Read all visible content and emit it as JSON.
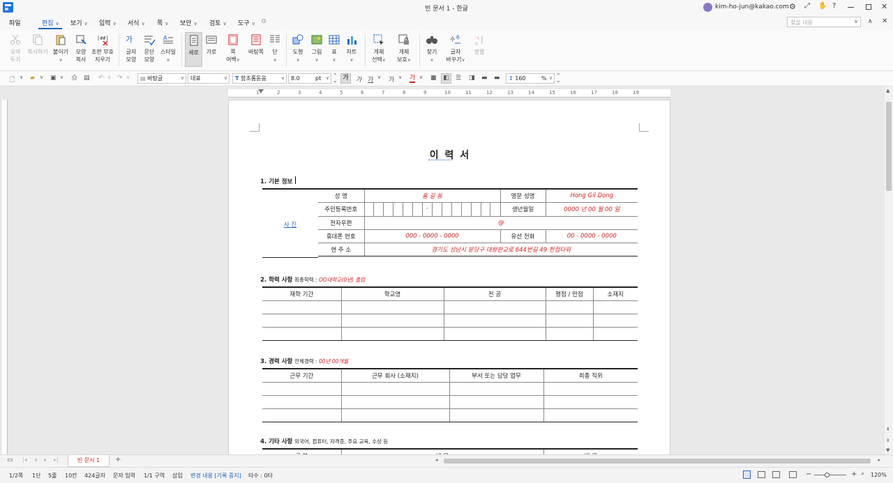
{
  "app": {
    "window_title": "빈 문서 1 - 한글",
    "user_email": "kim-ho-jun@kakao.com",
    "search_placeholder": "찾을 내용"
  },
  "menu": {
    "file": "파일",
    "items": [
      "편집",
      "보기",
      "입력",
      "서식",
      "쪽",
      "보안",
      "검토",
      "도구"
    ]
  },
  "ribbon": [
    {
      "label": "오려\n두기",
      "icon": "scissors-icon",
      "disabled": true
    },
    {
      "label": "복사하기",
      "icon": "copy-icon",
      "disabled": true
    },
    {
      "label": "붙이기",
      "icon": "paste-icon",
      "disabled": false
    },
    {
      "label": "모양\n복사",
      "icon": "format-painter-icon",
      "disabled": false
    },
    {
      "label": "조판 부호\n지우기",
      "icon": "clear-codes-icon",
      "disabled": false
    },
    {
      "label": "글자\n모양",
      "icon": "char-shape-icon",
      "disabled": false
    },
    {
      "label": "문단\n모양",
      "icon": "para-shape-icon",
      "disabled": false
    },
    {
      "label": "스타일",
      "icon": "style-icon",
      "disabled": false
    },
    {
      "label": "세로",
      "icon": "portrait-icon",
      "disabled": false
    },
    {
      "label": "가로",
      "icon": "landscape-icon",
      "disabled": false
    },
    {
      "label": "쪽\n여백",
      "icon": "margin-icon",
      "disabled": false
    },
    {
      "label": "바탕쪽",
      "icon": "master-page-icon",
      "disabled": false
    },
    {
      "label": "단",
      "icon": "columns-icon",
      "disabled": false
    },
    {
      "label": "도형",
      "icon": "shape-icon",
      "disabled": false
    },
    {
      "label": "그림",
      "icon": "picture-icon",
      "disabled": false
    },
    {
      "label": "표",
      "icon": "table-icon",
      "disabled": false
    },
    {
      "label": "차트",
      "icon": "chart-icon",
      "disabled": false
    },
    {
      "label": "개체\n선택",
      "icon": "select-object-icon",
      "disabled": false
    },
    {
      "label": "개체\n보호",
      "icon": "protect-object-icon",
      "disabled": false
    },
    {
      "label": "찾기",
      "icon": "find-icon",
      "disabled": false
    },
    {
      "label": "글자\n바꾸기",
      "icon": "replace-icon",
      "disabled": false
    },
    {
      "label": "정렬",
      "icon": "sort-icon",
      "disabled": true
    }
  ],
  "format": {
    "style": "바탕글",
    "outline": "대표",
    "font": "함초롬돋움",
    "size": "8.0",
    "unit": "pt",
    "line_spacing": "160",
    "line_unit": "%"
  },
  "ruler": [
    "1",
    "2",
    "3",
    "4",
    "5",
    "6",
    "7",
    "8",
    "9",
    "10",
    "11",
    "12",
    "13",
    "14",
    "15",
    "16",
    "17",
    "18",
    "19"
  ],
  "doc": {
    "title": "이 력 서",
    "s1_title": "1. 기본 정보",
    "photo": "사 진",
    "s1_rows": [
      {
        "l": "성 명",
        "v": "홍 길 동",
        "l2": "영문 성명",
        "v2": "Hong Gil Dong"
      },
      {
        "l": "주민등록번호",
        "v": "-",
        "l2": "생년월일",
        "v2": "0000 년 00 월 00 일"
      },
      {
        "l": "전자우편",
        "v": "@"
      },
      {
        "l": "휴대폰 번호",
        "v": "000 - 0000 - 0000",
        "l2": "유선 전화",
        "v2": "00 - 0000 - 0000"
      },
      {
        "l": "현 주 소",
        "v": "경기도 성남시 분당구 대왕판교로 644번길 49 한컴타워"
      }
    ],
    "s2_title": "2. 학력 사항",
    "s2_sub": "최종학력 : ",
    "s2_red": "OO대학교(0년) 졸업",
    "s2_headers": [
      "재학 기간",
      "학교명",
      "전 공",
      "평점 / 만점",
      "소재지"
    ],
    "s3_title": "3. 경력 사항",
    "s3_sub": "전체경력 : ",
    "s3_red": "00년 00개월",
    "s3_headers": [
      "근무 기간",
      "근무 회사 (소재지)",
      "부서 또는 담당 업무",
      "최종 직위"
    ],
    "s4_title": "4. 기타 사항",
    "s4_sub": "외국어, 컴퓨터, 자격증, 주요 교육, 수상 등",
    "s4_headers": [
      "구 분",
      "내 용",
      "비 고"
    ]
  },
  "tabs": {
    "doc_tab": "빈 문서 1"
  },
  "status": {
    "page": "1/2쪽",
    "col": "1단",
    "line": "5줄",
    "char": "10칸",
    "count": "424글자",
    "mode": "문자 입력",
    "section": "1/1 구역",
    "insert": "삽입",
    "track": "변경 내용 [기록 중지]",
    "strokes": "타수 : 0타",
    "zoom": "120%"
  },
  "colors": {
    "accent": "#1e63c4",
    "red_text": "#d32020",
    "brand": "#1e73e8"
  }
}
